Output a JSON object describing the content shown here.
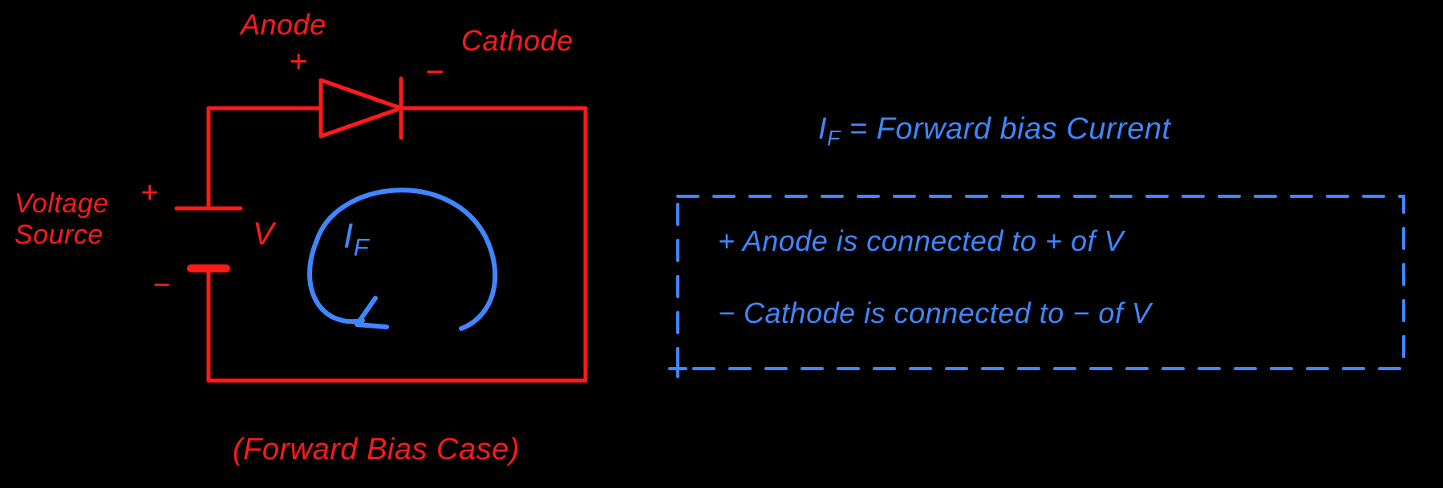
{
  "diagram": {
    "title": "(Forward Bias Case)",
    "voltage_source_label": "Voltage Source",
    "voltage_plus": "+",
    "voltage_minus": "−",
    "voltage_symbol": "V",
    "anode_label": "Anode",
    "anode_sign": "+",
    "cathode_label": "Cathode",
    "cathode_sign": "−",
    "current_symbol_main": "I",
    "current_symbol_sub": "F"
  },
  "notes": {
    "definition_main": "I",
    "definition_sub": "F",
    "definition_eq": " = Forward bias Current",
    "line1": "+ Anode is connected to + of V",
    "line2": "− Cathode is connected to − of V"
  }
}
